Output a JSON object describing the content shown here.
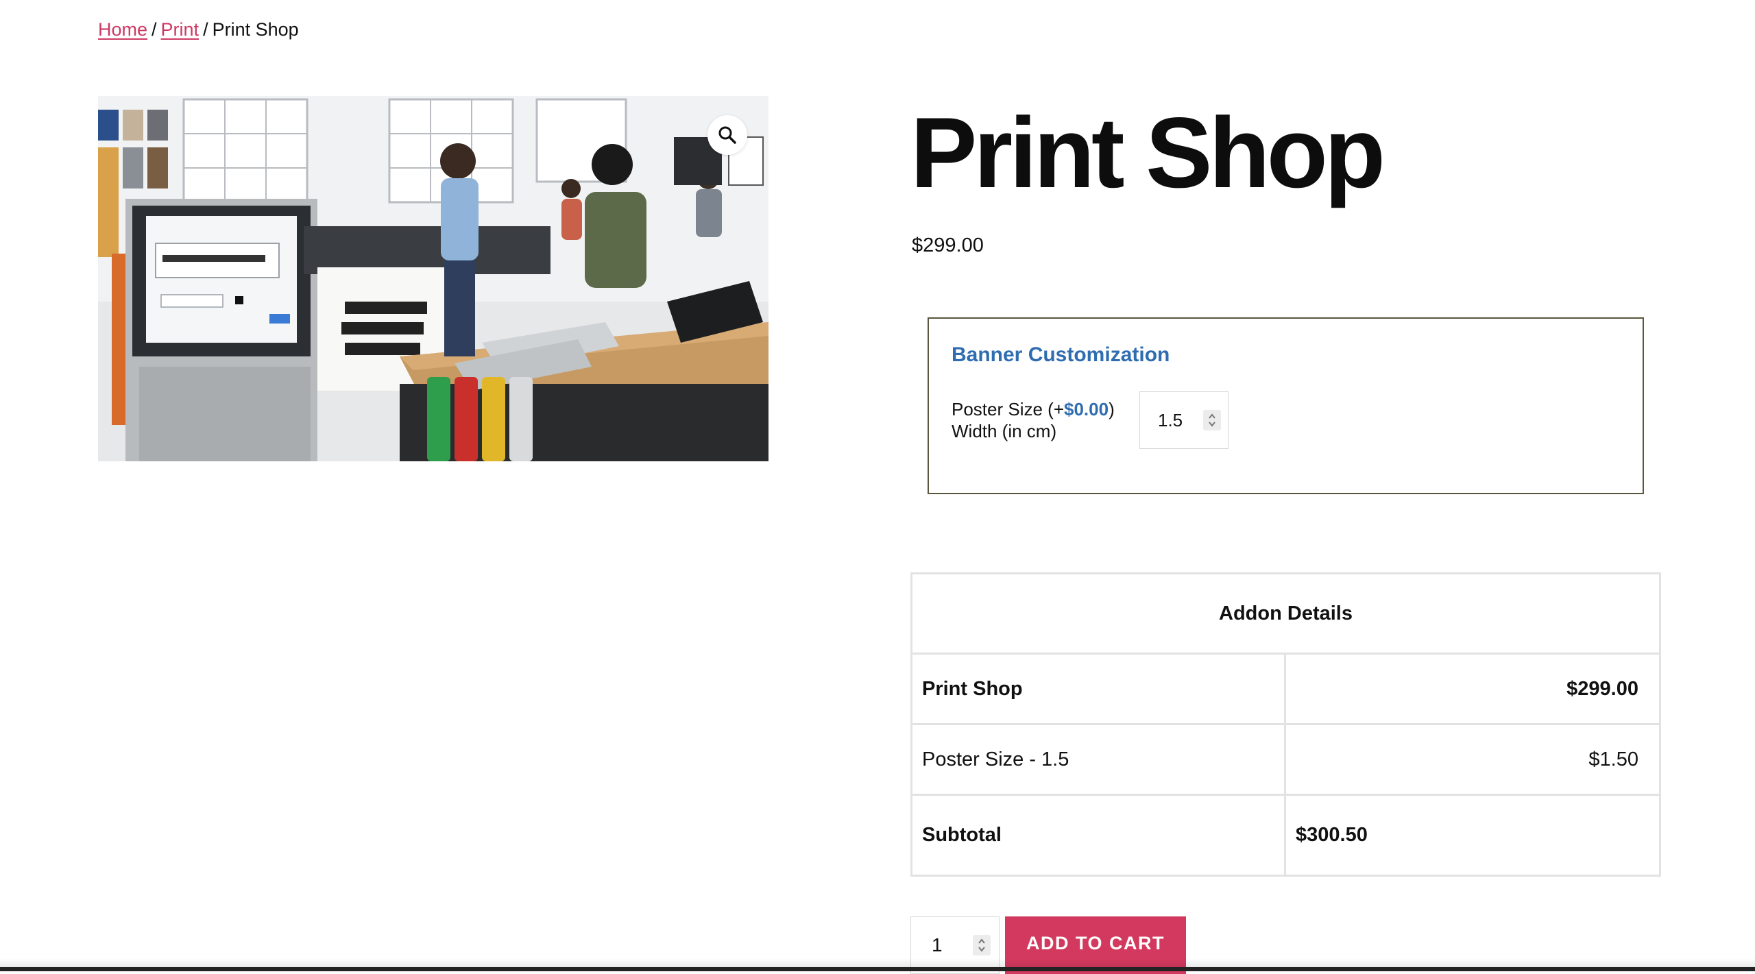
{
  "breadcrumb": {
    "items": [
      {
        "label": "Home"
      },
      {
        "label": "Print"
      }
    ],
    "current": "Print Shop",
    "separator": "/"
  },
  "product": {
    "title": "Print Shop",
    "price": "$299.00",
    "image_icons": [
      "zoom-icon"
    ]
  },
  "customization": {
    "title": "Banner Customization",
    "field_label_prefix": "Poster Size (+",
    "field_price": "$0.00",
    "field_label_suffix": ")",
    "field_label_line2": "Width (in cm)",
    "field_value": "1.5"
  },
  "addon_details": {
    "heading": "Addon Details",
    "rows": [
      {
        "label": "Print Shop",
        "value": "$299.00"
      },
      {
        "label": "Poster Size - 1.5",
        "value": "$1.50"
      }
    ],
    "subtotal_label": "Subtotal",
    "subtotal_value": "$300.50"
  },
  "cart": {
    "quantity": "1",
    "add_to_cart_label": "ADD TO CART"
  },
  "colors": {
    "accent": "#cc3a64",
    "button": "#d3395e",
    "customization_title": "#2f6db0",
    "custom_box_border": "#5a553e"
  }
}
